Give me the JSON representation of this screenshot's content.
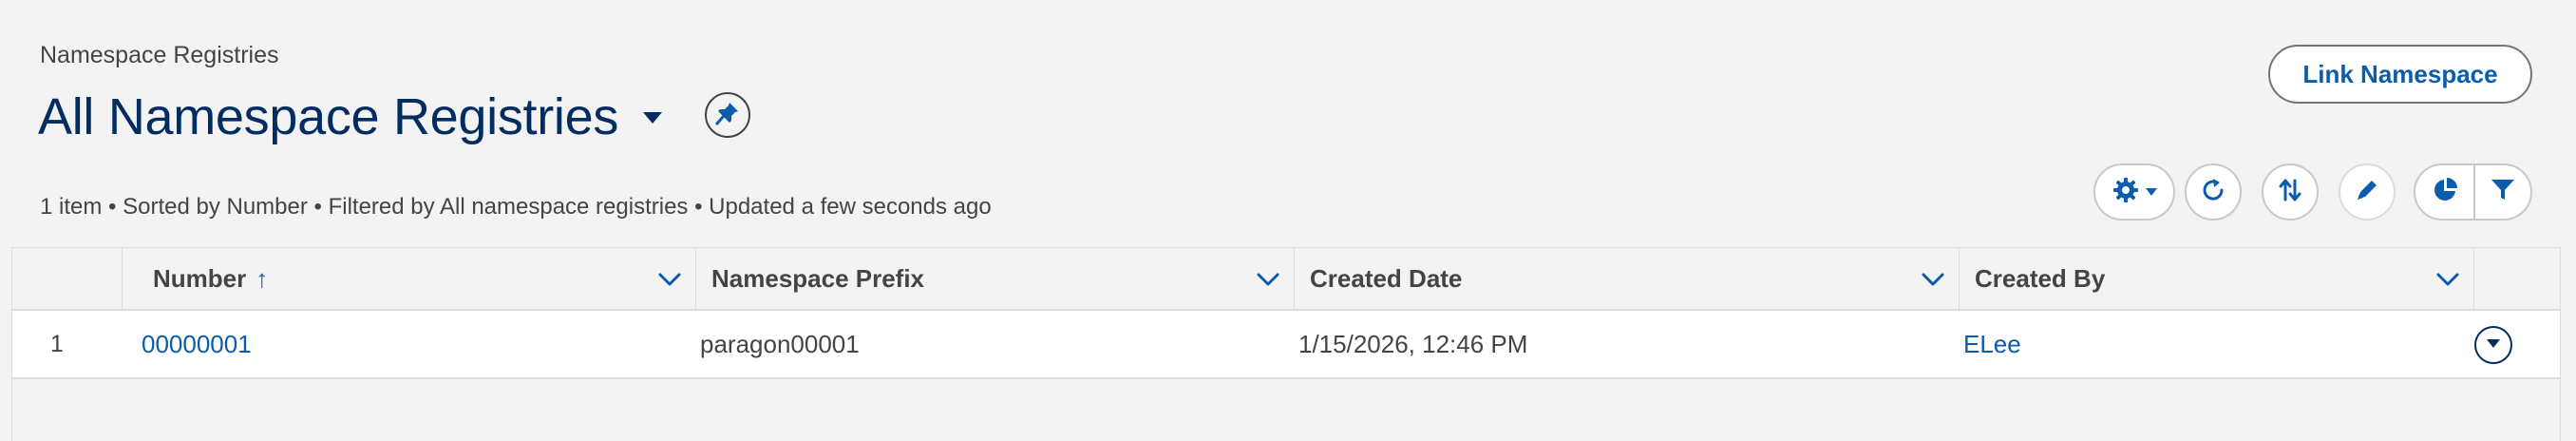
{
  "header": {
    "object_label": "Namespace Registries",
    "list_view_title": "All Namespace Registries",
    "link_button_label": "Link Namespace",
    "meta": "1 item • Sorted by Number • Filtered by All namespace registries • Updated a few seconds ago"
  },
  "toolbar": {
    "icons": [
      "gear-icon",
      "refresh-icon",
      "sort-icon",
      "pencil-icon",
      "pie-chart-icon",
      "filter-icon"
    ]
  },
  "table": {
    "columns": [
      {
        "label": "Number",
        "sort_indicator": "↑"
      },
      {
        "label": "Namespace Prefix"
      },
      {
        "label": "Created Date"
      },
      {
        "label": "Created By"
      }
    ],
    "rows": [
      {
        "index": "1",
        "number": "00000001",
        "namespace_prefix": "paragon00001",
        "created_date": "1/15/2026, 12:46 PM",
        "created_by": "ELee"
      }
    ]
  },
  "colors": {
    "brand_blue": "#0b5cab",
    "title_navy": "#032d60",
    "background": "#f3f3f3"
  }
}
